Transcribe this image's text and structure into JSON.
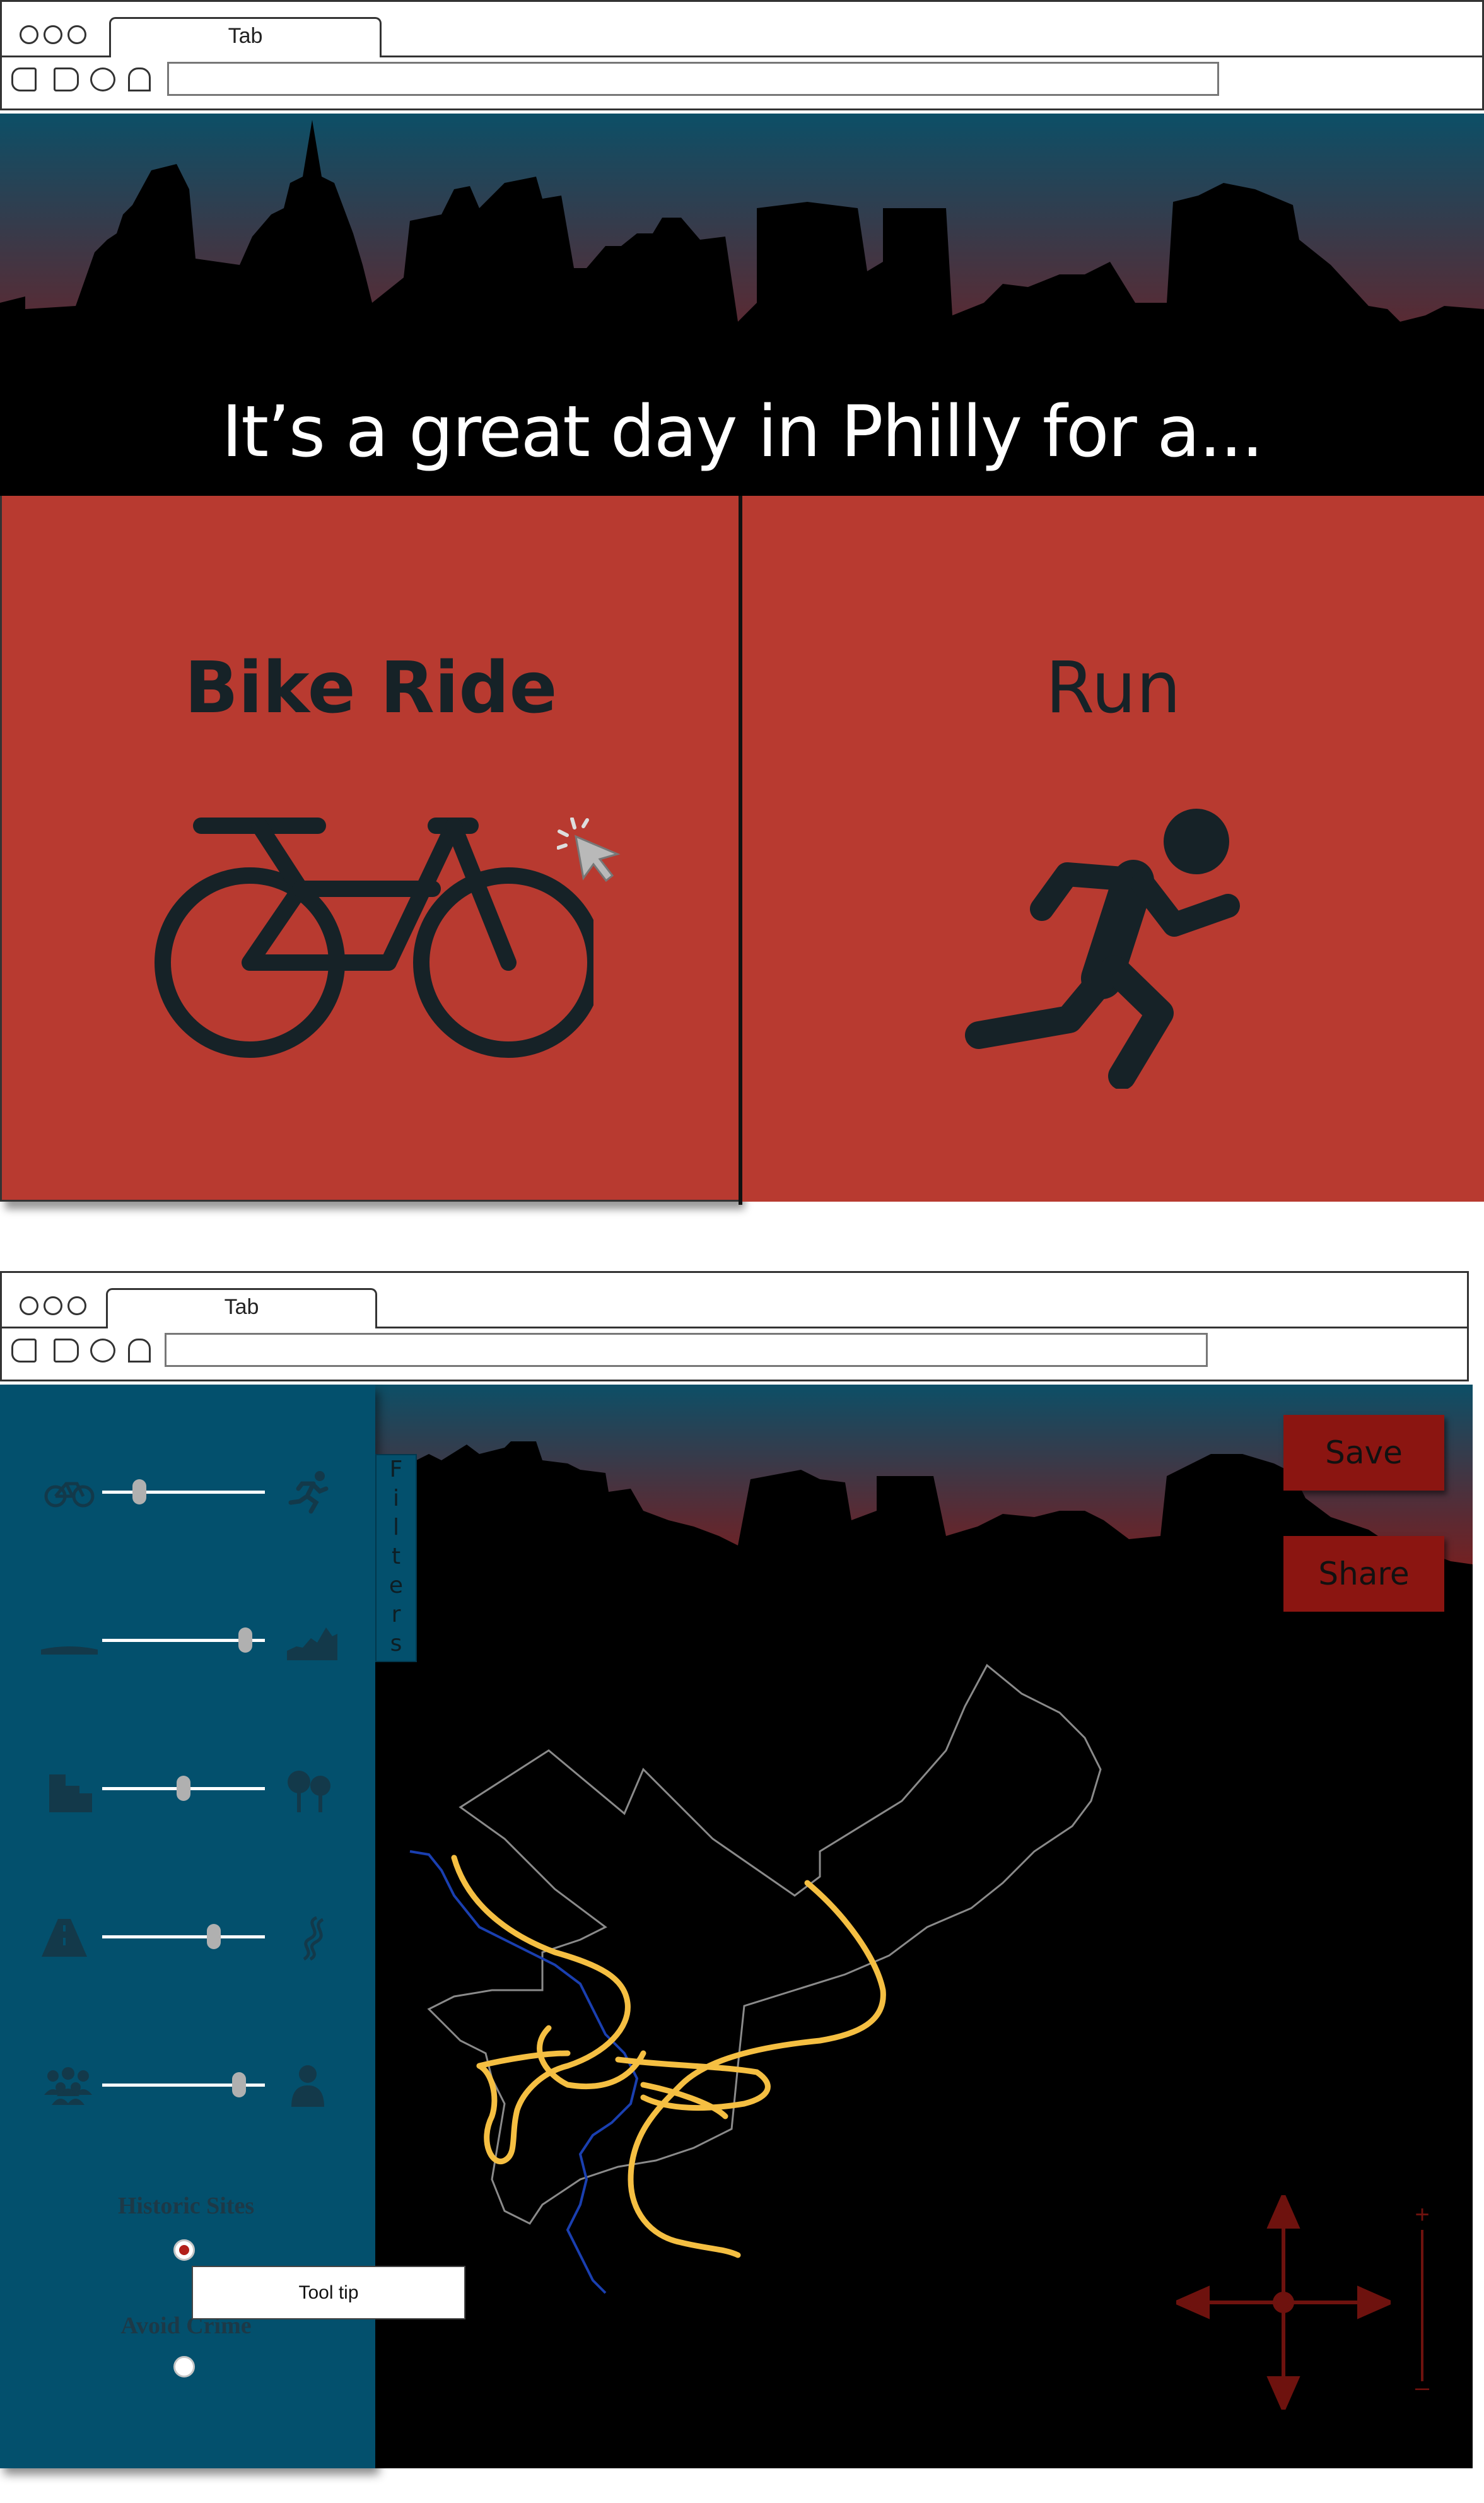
{
  "frame1": {
    "browser": {
      "tab_label": "Tab",
      "url": ""
    },
    "headline": "It’s a great day in Philly for a...",
    "options": [
      {
        "label": "Bike Ride",
        "icon": "bicycle-icon",
        "selected": true
      },
      {
        "label": "Run",
        "icon": "runner-icon",
        "selected": false
      }
    ],
    "cursor_icon": "pointer-cursor-icon"
  },
  "frame2": {
    "browser": {
      "tab_label": "Tab",
      "url": ""
    },
    "filters_tab_label": "Filters",
    "filters_tab_letters": [
      "F",
      "i",
      "l",
      "t",
      "e",
      "r",
      "s"
    ],
    "sliders": [
      {
        "left_icon": "bicycle-icon",
        "right_icon": "runner-icon",
        "value": 0.22
      },
      {
        "left_icon": "flat-terrain-icon",
        "right_icon": "hilly-terrain-icon",
        "value": 0.9
      },
      {
        "left_icon": "city-buildings-icon",
        "right_icon": "trees-icon",
        "value": 0.5
      },
      {
        "left_icon": "road-icon",
        "right_icon": "trail-icon",
        "value": 0.68
      },
      {
        "left_icon": "crowd-icon",
        "right_icon": "single-person-icon",
        "value": 0.86
      }
    ],
    "toggles": [
      {
        "label": "Historic Sites",
        "checked": true
      },
      {
        "label": "Avoid Crime",
        "checked": false
      }
    ],
    "tooltip": "Tool tip",
    "buttons": {
      "save": "Save",
      "share": "Share"
    },
    "zoom": {
      "plus": "+",
      "minus": "–"
    },
    "colors": {
      "panel_red": "#b83a30",
      "sidebar_blue": "#03506d",
      "button_red": "#8b1511",
      "route_yellow": "#f5bf42",
      "river_blue": "#1a3fb0",
      "sky_top": "#0c4f67",
      "sky_bottom": "#8a1a14"
    }
  }
}
